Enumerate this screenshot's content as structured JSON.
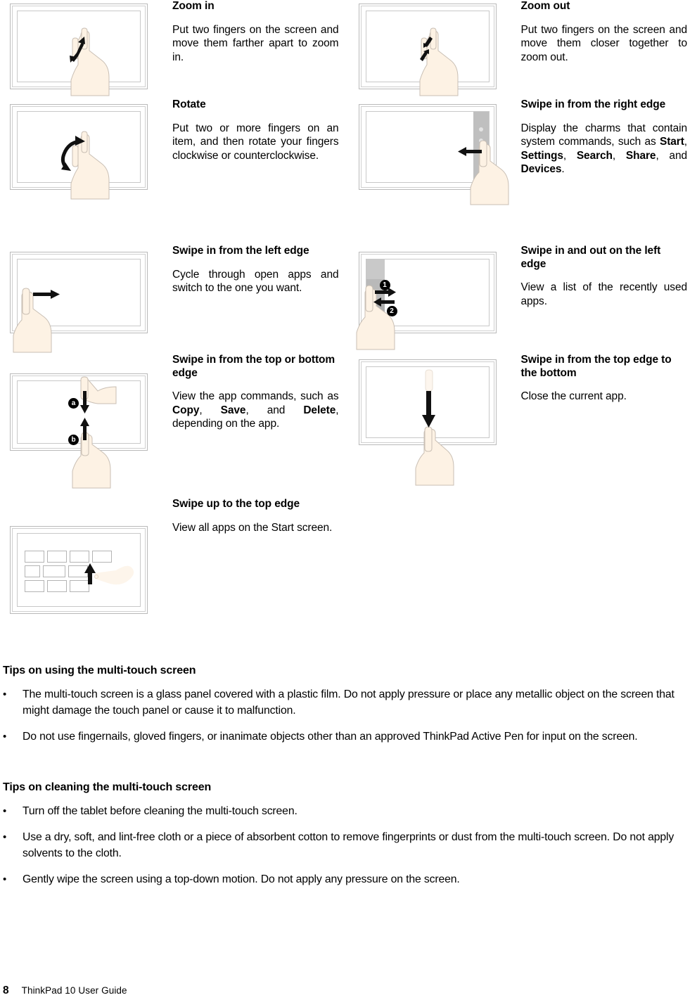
{
  "document": {
    "page_number": "8",
    "guide_title": "ThinkPad 10 User Guide"
  },
  "gestures": [
    {
      "id": "zoom-in",
      "title": "Zoom in",
      "description": "Put two fingers on the screen and move them farther apart to zoom in.",
      "figure": "tablet-two-finger-spread"
    },
    {
      "id": "zoom-out",
      "title": "Zoom out",
      "description": "Put two fingers on the screen and move them closer together to zoom out.",
      "figure": "tablet-two-finger-pinch"
    },
    {
      "id": "rotate",
      "title": "Rotate",
      "description": "Put two or more fingers on an item, and then rotate your fingers clockwise or counterclockwise.",
      "figure": "tablet-two-finger-rotate"
    },
    {
      "id": "swipe-in-right-edge",
      "title": "Swipe in from the right edge",
      "description_parts": [
        {
          "text": "Display the charms that contain system commands, such as ",
          "bold": false
        },
        {
          "text": "Start",
          "bold": true
        },
        {
          "text": ", ",
          "bold": false
        },
        {
          "text": "Settings",
          "bold": true
        },
        {
          "text": ", ",
          "bold": false
        },
        {
          "text": "Search",
          "bold": true
        },
        {
          "text": ", ",
          "bold": false
        },
        {
          "text": "Share",
          "bold": true
        },
        {
          "text": ", and ",
          "bold": false
        },
        {
          "text": "Devices",
          "bold": true
        },
        {
          "text": ".",
          "bold": false
        }
      ],
      "figure": "tablet-swipe-right-edge"
    },
    {
      "id": "swipe-in-left-edge",
      "title": "Swipe in from the left edge",
      "description": "Cycle through open apps and switch to the one you want.",
      "figure": "tablet-swipe-left-edge"
    },
    {
      "id": "swipe-in-out-left-edge",
      "title": "Swipe in and out on the left edge",
      "description": "View a list of the recently used apps.",
      "figure": "tablet-swipe-in-out-left",
      "markers": [
        "1",
        "2"
      ]
    },
    {
      "id": "swipe-top-bottom-edge",
      "title": "Swipe in from the top or bottom edge",
      "description_parts": [
        {
          "text": "View the app commands, such as ",
          "bold": false
        },
        {
          "text": "Copy",
          "bold": true
        },
        {
          "text": ", ",
          "bold": false
        },
        {
          "text": "Save",
          "bold": true
        },
        {
          "text": ", and ",
          "bold": false
        },
        {
          "text": "Delete",
          "bold": true
        },
        {
          "text": ", depending on the app.",
          "bold": false
        }
      ],
      "figure": "tablet-swipe-top-bottom",
      "markers": [
        "a",
        "b"
      ]
    },
    {
      "id": "swipe-top-to-bottom",
      "title": "Swipe in from the top edge to the bottom",
      "description": "Close the current app.",
      "figure": "tablet-swipe-top-to-bottom"
    },
    {
      "id": "swipe-up-top-edge",
      "title": "Swipe up to the top edge",
      "description": "View all apps on the Start screen.",
      "figure": "tablet-start-screen-tiles"
    }
  ],
  "tips_using": {
    "heading": "Tips on using the multi-touch screen",
    "bullet_char": "•",
    "items": [
      "The multi-touch screen is a glass panel covered with a plastic film.  Do not apply pressure or place any metallic object on the screen that might damage the touch panel or cause it to malfunction.",
      "Do not use fingernails, gloved fingers, or inanimate objects other than an approved ThinkPad Active Pen for input on the screen."
    ]
  },
  "tips_cleaning": {
    "heading": "Tips on cleaning the multi-touch screen",
    "bullet_char": "•",
    "items": [
      "Turn off the tablet before cleaning the multi-touch screen.",
      "Use a dry, soft, and lint-free cloth or a piece of absorbent cotton to remove fingerprints or dust from the multi-touch screen.  Do not apply solvents to the cloth.",
      "Gently wipe the screen using a top-down motion.  Do not apply any pressure on the screen."
    ]
  },
  "colors": {
    "text": "#000000",
    "bezel_outer": "#b9b9b9",
    "bezel_inner": "#cfcfcf",
    "screen_border": "#c8c8c8",
    "edge_bar": "#bfbfbf",
    "hand_fill": "#fdf2e4",
    "hand_stroke": "#c9bfb4",
    "tile_border": "#b4b4b4"
  }
}
